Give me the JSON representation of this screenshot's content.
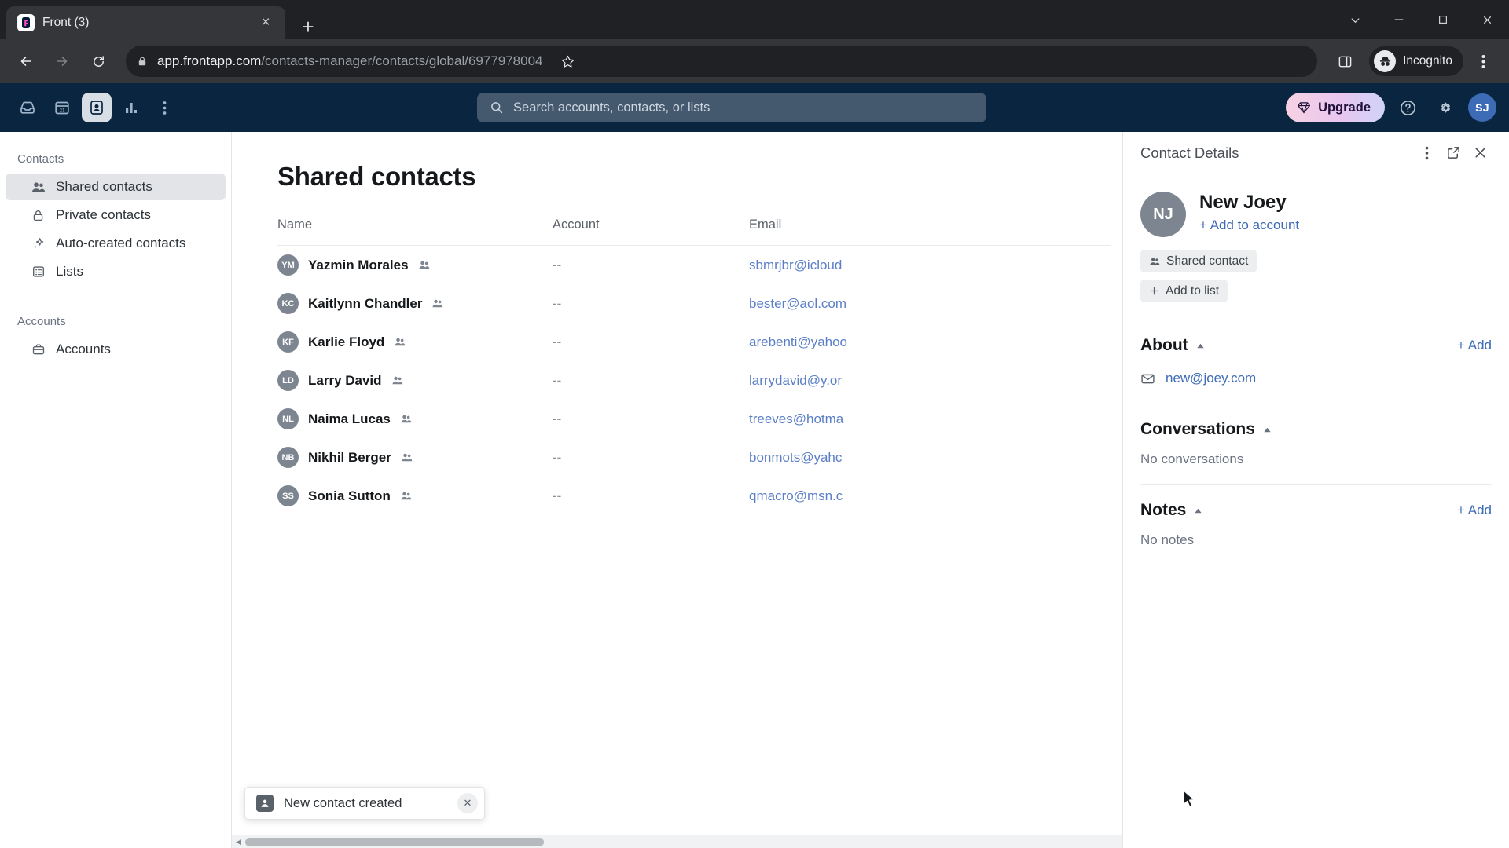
{
  "browser": {
    "tab": {
      "title": "Front (3)",
      "favicon": "front-logo-icon",
      "close": "×"
    },
    "new_tab_label": "+",
    "url_domain": "app.frontapp.com",
    "url_path": "/contacts-manager/contacts/global/6977978004",
    "profile_label": "Incognito",
    "window_controls": {
      "minimize": "—",
      "maximize": "▢",
      "close": "✕",
      "expand": "⌄"
    }
  },
  "app_header": {
    "search_placeholder": "Search accounts, contacts, or lists",
    "upgrade_label": "Upgrade",
    "user_initials": "SJ",
    "nav_icons": [
      "inbox-icon",
      "calendar-icon",
      "contacts-icon",
      "analytics-icon",
      "more-icon"
    ]
  },
  "sidebar": {
    "groups": [
      {
        "label": "Contacts",
        "items": [
          {
            "label": "Shared contacts",
            "icon": "shared-contacts-icon",
            "active": true
          },
          {
            "label": "Private contacts",
            "icon": "lock-icon",
            "active": false
          },
          {
            "label": "Auto-created contacts",
            "icon": "sparkle-icon",
            "active": false
          },
          {
            "label": "Lists",
            "icon": "list-icon",
            "active": false
          }
        ]
      },
      {
        "label": "Accounts",
        "items": [
          {
            "label": "Accounts",
            "icon": "briefcase-icon",
            "active": false
          }
        ]
      }
    ]
  },
  "main": {
    "title": "Shared contacts",
    "columns": [
      "Name",
      "Account",
      "Email"
    ],
    "rows": [
      {
        "initials": "YM",
        "name": "Yazmin Morales",
        "account": "--",
        "email": "sbmrjbr@icloud"
      },
      {
        "initials": "KC",
        "name": "Kaitlynn Chandler",
        "account": "--",
        "email": "bester@aol.com"
      },
      {
        "initials": "KF",
        "name": "Karlie Floyd",
        "account": "--",
        "email": "arebenti@yahoo"
      },
      {
        "initials": "LD",
        "name": "Larry David",
        "account": "--",
        "email": "larrydavid@y.or"
      },
      {
        "initials": "NL",
        "name": "Naima Lucas",
        "account": "--",
        "email": "treeves@hotma"
      },
      {
        "initials": "NB",
        "name": "Nikhil Berger",
        "account": "--",
        "email": "bonmots@yahc"
      },
      {
        "initials": "SS",
        "name": "Sonia Sutton",
        "account": "--",
        "email": "qmacro@msn.c"
      }
    ]
  },
  "details": {
    "title": "Contact Details",
    "avatar_initials": "NJ",
    "name": "New Joey",
    "add_to_account": "+ Add to account",
    "chips": [
      {
        "label": "Shared contact",
        "icon": "shared-contacts-icon"
      },
      {
        "label": "Add to list",
        "icon": "plus-icon"
      }
    ],
    "sections": [
      {
        "key": "about",
        "title": "About",
        "add_label": "+ Add",
        "email": "new@joey.com"
      },
      {
        "key": "conversations",
        "title": "Conversations",
        "empty": "No conversations"
      },
      {
        "key": "notes",
        "title": "Notes",
        "add_label": "+ Add",
        "empty": "No notes"
      }
    ]
  },
  "toast": {
    "message": "New contact created",
    "icon": "contact-icon",
    "close": "✕"
  },
  "colors": {
    "app_header_bg": "#0a2540",
    "link": "#3d6bb5",
    "avatar": "#7d8590",
    "sidebar_active": "#e2e4e7"
  }
}
